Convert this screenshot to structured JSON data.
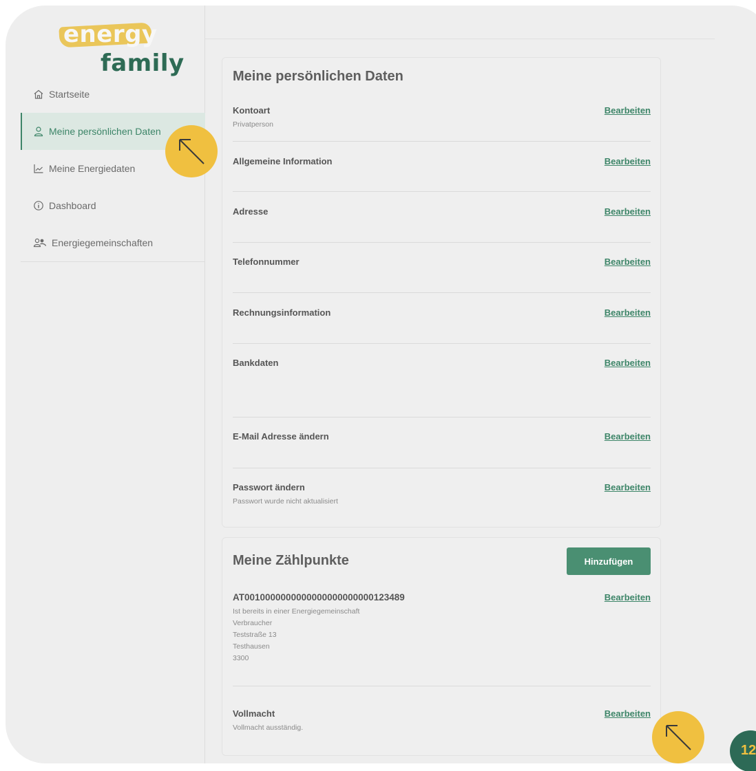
{
  "logo": {
    "word1": "energy",
    "word2": "family"
  },
  "sidebar": {
    "items": [
      {
        "label": "Startseite",
        "icon": "home-icon"
      },
      {
        "label": "Meine persönlichen Daten",
        "icon": "user-icon",
        "active": true
      },
      {
        "label": "Meine Energiedaten",
        "icon": "chart-icon"
      },
      {
        "label": "Dashboard",
        "icon": "info-icon"
      },
      {
        "label": "Energiegemeinschaften",
        "icon": "users-icon"
      }
    ]
  },
  "personal": {
    "title": "Meine persönlichen Daten",
    "edit_label": "Bearbeiten",
    "rows": [
      {
        "label": "Kontoart",
        "sub": "Privatperson"
      },
      {
        "label": "Allgemeine Information",
        "sub": ""
      },
      {
        "label": "Adresse",
        "sub": ""
      },
      {
        "label": "Telefonnummer",
        "sub": ""
      },
      {
        "label": "Rechnungsinformation",
        "sub": ""
      },
      {
        "label": "Bankdaten",
        "sub": ""
      },
      {
        "label": "E-Mail Adresse ändern",
        "sub": ""
      },
      {
        "label": "Passwort ändern",
        "sub": "Passwort wurde nicht aktualisiert"
      }
    ]
  },
  "meters": {
    "title": "Meine Zählpunkte",
    "add_label": "Hinzufügen",
    "edit_label": "Bearbeiten",
    "meter": {
      "id": "AT0010000000000000000000000123489",
      "lines": [
        "Ist bereits in einer Energiegemeinschaft",
        "Verbraucher",
        "Teststraße 13",
        "Testhausen",
        "3300"
      ]
    },
    "proxy": {
      "label": "Vollmacht",
      "sub": "Vollmacht ausständig."
    }
  },
  "page_number": "12",
  "colors": {
    "accent": "#3d8568",
    "button": "#4a8f72",
    "highlight": "#f0c040",
    "badge": "#2d6a56"
  }
}
